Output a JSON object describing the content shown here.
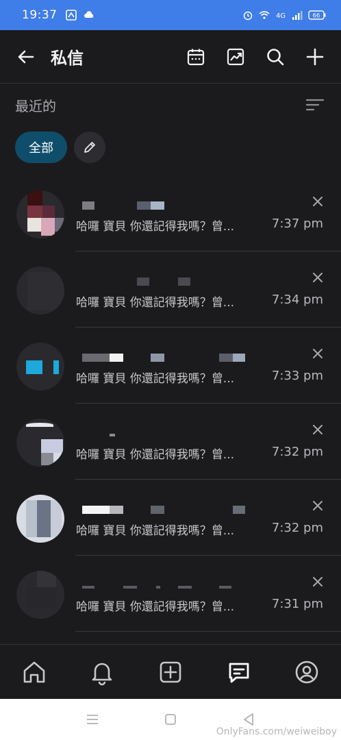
{
  "status_bar": {
    "time": "19:37",
    "battery": "66"
  },
  "header": {
    "title": "私信"
  },
  "section": {
    "label": "最近的"
  },
  "chips": {
    "all_label": "全部"
  },
  "conversations": [
    {
      "message": "哈囉 寶貝 你還記得我嗎？曾...",
      "time": "7:37 pm"
    },
    {
      "message": "哈囉 寶貝 你還記得我嗎？曾...",
      "time": "7:34 pm"
    },
    {
      "message": "哈囉 寶貝 你還記得我嗎？曾...",
      "time": "7:33 pm"
    },
    {
      "message": "哈囉 寶貝 你還記得我嗎？曾...",
      "time": "7:32 pm"
    },
    {
      "message": "哈囉 寶貝 你還記得我嗎？曾...",
      "time": "7:32 pm"
    },
    {
      "message": "哈囉 寶貝 你還記得我嗎？曾...",
      "time": "7:31 pm"
    }
  ],
  "watermark": "OnlyFans.com/weiweiboy",
  "colors": {
    "status_bar": "#3f7de8",
    "background": "#1b1b1d",
    "chip_active": "#0f4e6b"
  }
}
